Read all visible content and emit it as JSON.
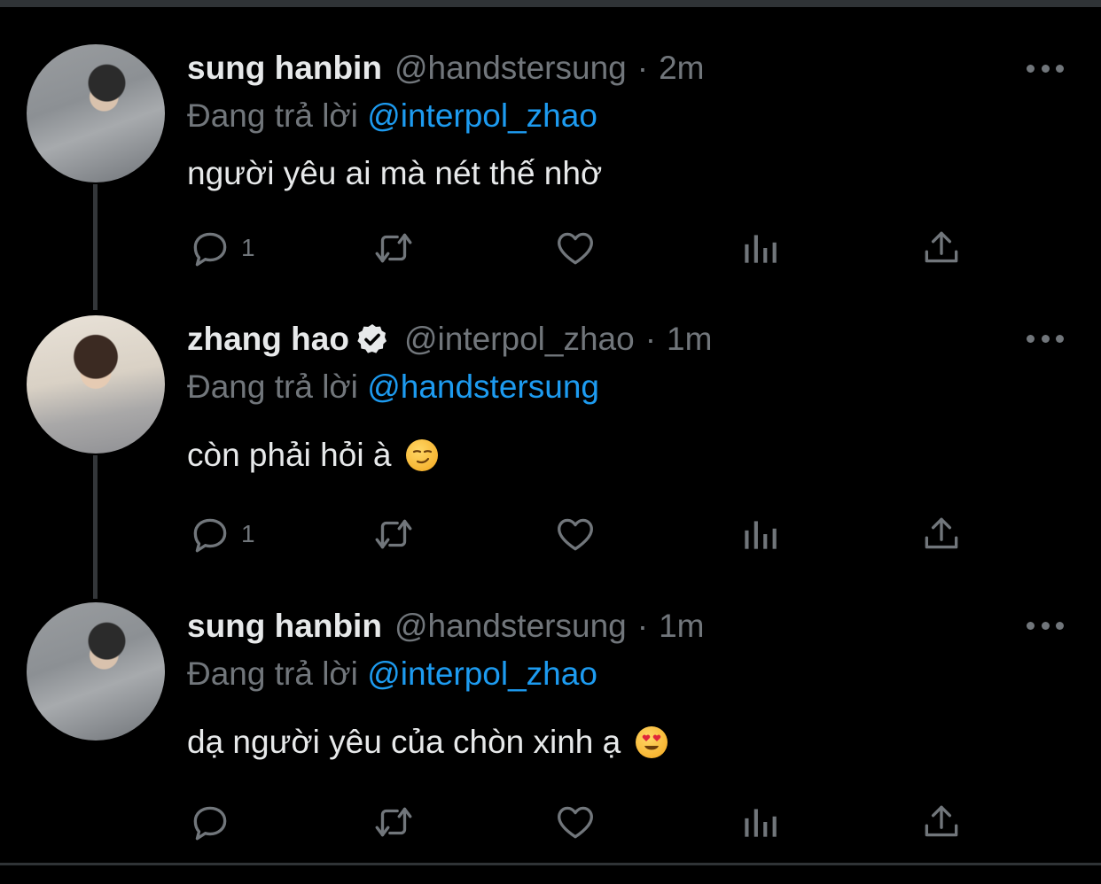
{
  "tweets": [
    {
      "name": "sung hanbin",
      "verified": false,
      "handle": "@handstersung",
      "time": "2m",
      "reply_prefix": "Đang trả lời",
      "reply_to": "@interpol_zhao",
      "text": "người yêu ai mà nét thế nhờ",
      "emoji": "",
      "reply_count": "1",
      "avatar": "avatar-sung-hanbin"
    },
    {
      "name": "zhang hao",
      "verified": true,
      "handle": "@interpol_zhao",
      "time": "1m",
      "reply_prefix": "Đang trả lời",
      "reply_to": "@handstersung",
      "text": "còn phải hỏi à",
      "emoji": "smirking-face",
      "reply_count": "1",
      "avatar": "avatar-zhang-hao"
    },
    {
      "name": "sung hanbin",
      "verified": false,
      "handle": "@handstersung",
      "time": "1m",
      "reply_prefix": "Đang trả lời",
      "reply_to": "@interpol_zhao",
      "text": "dạ người yêu của chòn xinh ạ",
      "emoji": "heart-eyes-face",
      "reply_count": "",
      "avatar": "avatar-sung-hanbin"
    }
  ],
  "dot_separator": "·",
  "colors": {
    "background": "#000000",
    "text": "#e7e9ea",
    "muted": "#71767b",
    "link": "#1d9bf0",
    "divider": "#2f3336"
  },
  "icons": [
    "reply-icon",
    "retweet-icon",
    "like-icon",
    "analytics-icon",
    "share-icon",
    "more-icon",
    "verified-badge-icon"
  ]
}
